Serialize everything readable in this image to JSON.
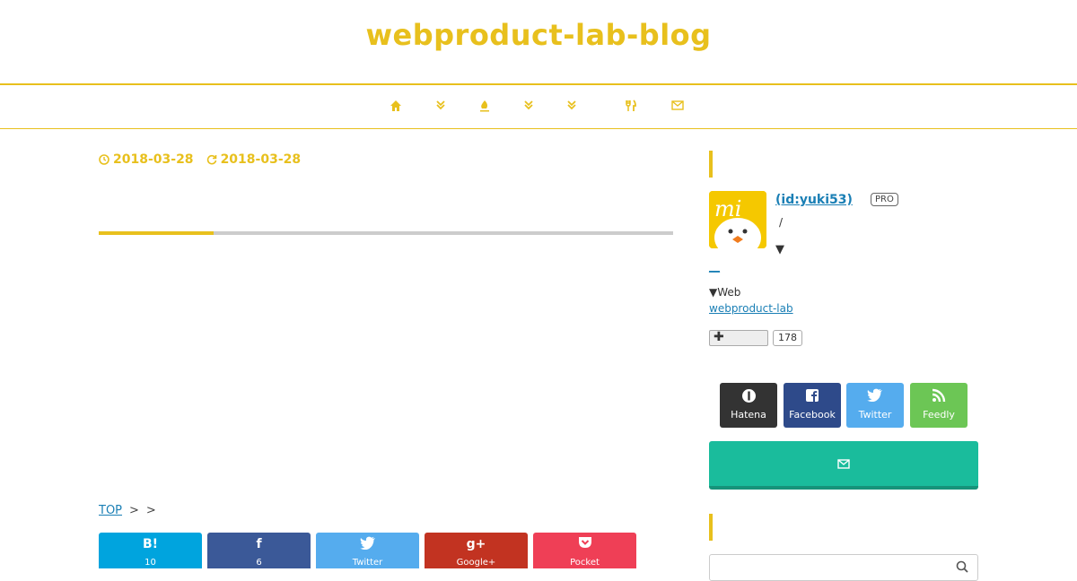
{
  "site": {
    "title": "webproduct-lab-blog"
  },
  "nav": {
    "items": [
      {
        "icon": "home-icon"
      },
      {
        "icon": "chevron-double-down-icon"
      },
      {
        "icon": "flame-icon"
      },
      {
        "icon": "chevron-double-down-icon"
      },
      {
        "icon": "chevron-double-down-icon"
      },
      {
        "icon": "cutlery-icon"
      },
      {
        "icon": "mail-icon"
      }
    ]
  },
  "article": {
    "published_date": "2018-03-28",
    "updated_date": "2018-03-28",
    "read_progress": 0.2
  },
  "breadcrumb": {
    "top_label": "TOP",
    "sep1": ">",
    "sep2": ">"
  },
  "share": [
    {
      "name": "hatena",
      "icon": "B!",
      "label": "10",
      "color": "#00a4de"
    },
    {
      "name": "facebook",
      "icon": "f",
      "label": "6",
      "color": "#3b5998"
    },
    {
      "name": "twitter",
      "icon": "🐦",
      "label": "Twitter",
      "color": "#55acee"
    },
    {
      "name": "googleplus",
      "icon": "g+",
      "label": "Google+",
      "color": "#c23321"
    },
    {
      "name": "pocket",
      "icon": "⌄",
      "label": "Pocket",
      "color": "#ef3f56"
    }
  ],
  "profile": {
    "name": " (id:yuki53)",
    "badge": "PRO",
    "slash": "/",
    "toggle1": "▼",
    "underline_link": "__",
    "web_label": "▼Web",
    "web_link": "webproduct-lab",
    "bookmark_count": "178"
  },
  "follow": [
    {
      "name": "hatena",
      "label": "Hatena",
      "color": "#333333"
    },
    {
      "name": "facebook",
      "label": "Facebook",
      "color": "#2e4a8a"
    },
    {
      "name": "twitter",
      "label": "Twitter",
      "color": "#55acee"
    },
    {
      "name": "feedly",
      "label": "Feedly",
      "color": "#6cc655"
    }
  ],
  "colors": {
    "accent": "#e8c01d",
    "subscribe": "#1abc9c"
  }
}
